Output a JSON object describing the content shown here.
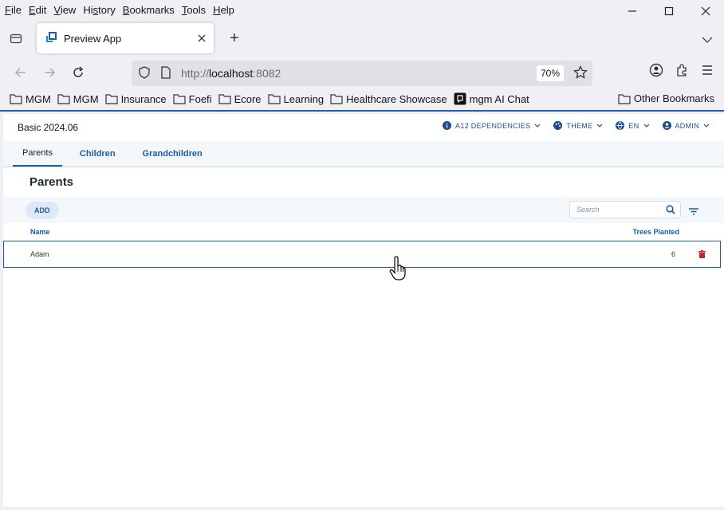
{
  "menu": [
    "File",
    "Edit",
    "View",
    "History",
    "Bookmarks",
    "Tools",
    "Help"
  ],
  "menu_accel": [
    "F",
    "E",
    "V",
    "s",
    "B",
    "T",
    "H"
  ],
  "tab": {
    "title": "Preview App"
  },
  "url": {
    "scheme": "http://",
    "host": "localhost",
    "port": ":8082",
    "zoom": "70%"
  },
  "bookmarks": [
    "MGM",
    "MGM",
    "Insurance",
    "Foefi",
    "Ecore",
    "Learning",
    "Healthcare Showcase",
    "mgm AI Chat"
  ],
  "other_bookmarks": "Other Bookmarks",
  "app": {
    "title": "Basic 2024.06",
    "header_items": [
      "A12 DEPENDENCIES",
      "THEME",
      "EN",
      "ADMIN"
    ],
    "tabs": [
      "Parents",
      "Children",
      "Grandchildren"
    ],
    "section_title": "Parents",
    "add_label": "ADD",
    "search_placeholder": "Search",
    "columns": [
      "Name",
      "Trees Planted"
    ],
    "rows": [
      {
        "name": "Adam",
        "trees": "6"
      }
    ]
  },
  "colors": {
    "accent": "#1b5ea0",
    "delete": "#c0262d"
  }
}
